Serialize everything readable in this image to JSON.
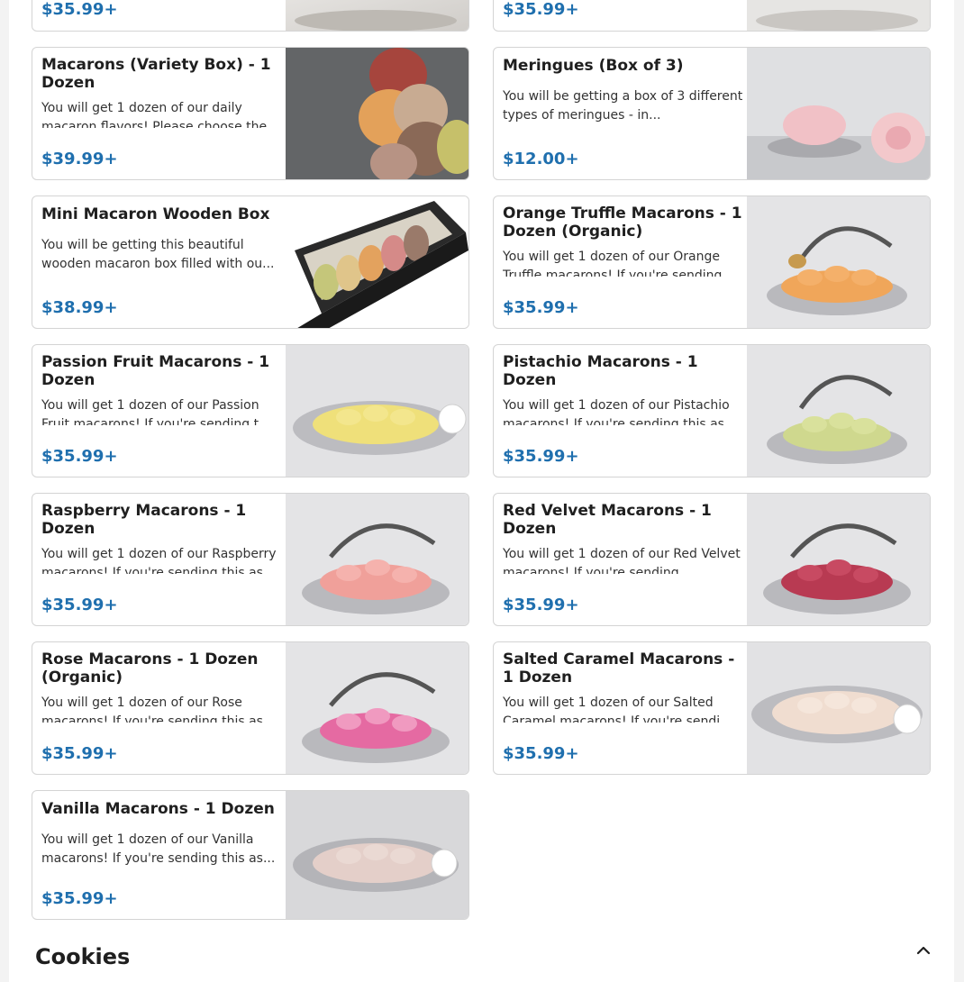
{
  "top_cards": [
    {
      "price": "$35.99+"
    },
    {
      "price": "$35.99+"
    }
  ],
  "items": [
    {
      "title": "Macarons (Variety Box) - 1 Dozen",
      "desc": "You will get 1 dozen of our daily macaron flavors! Please choose the",
      "price": "$39.99+",
      "image": "variety-macarons-image"
    },
    {
      "title": "Meringues (Box of 3)",
      "desc": "You will be getting a box of 3 different types of meringues - in...",
      "price": "$12.00+",
      "image": "meringues-image"
    },
    {
      "title": "Mini Macaron Wooden Box",
      "desc": "You will be getting this beautiful wooden macaron box filled with ou...",
      "price": "$38.99+",
      "image": "wooden-box-image"
    },
    {
      "title": "Orange Truffle Macarons - 1 Dozen (Organic)",
      "desc": "You will get 1 dozen of our Orange Truffle macarons! If you're sending",
      "price": "$35.99+",
      "image": "orange-macarons-image"
    },
    {
      "title": "Passion Fruit Macarons - 1 Dozen",
      "desc": "You will get 1 dozen of our Passion Fruit macarons! If you're sending t",
      "price": "$35.99+",
      "image": "passion-fruit-macarons-image"
    },
    {
      "title": "Pistachio Macarons - 1 Dozen",
      "desc": "You will get 1 dozen of our Pistachio macarons! If you're sending this as",
      "price": "$35.99+",
      "image": "pistachio-macarons-image"
    },
    {
      "title": "Raspberry Macarons - 1 Dozen",
      "desc": "You will get 1 dozen of our Raspberry macarons! If you're sending this as",
      "price": "$35.99+",
      "image": "raspberry-macarons-image"
    },
    {
      "title": "Red Velvet Macarons - 1 Dozen",
      "desc": "You will get 1 dozen of our Red Velvet macarons! If you're sending",
      "price": "$35.99+",
      "image": "red-velvet-macarons-image"
    },
    {
      "title": "Rose Macarons - 1 Dozen (Organic)",
      "desc": "You will get 1 dozen of our Rose macarons! If you're sending this as",
      "price": "$35.99+",
      "image": "rose-macarons-image"
    },
    {
      "title": "Salted Caramel Macarons - 1 Dozen",
      "desc": "You will get 1 dozen of our Salted Caramel macarons! If you're sendi",
      "price": "$35.99+",
      "image": "salted-caramel-macarons-image"
    },
    {
      "title": "Vanilla Macarons - 1 Dozen",
      "desc": "You will get 1 dozen of our Vanilla macarons! If you're sending this as...",
      "price": "$35.99+",
      "image": "vanilla-macarons-image"
    }
  ],
  "section": {
    "title": "Cookies",
    "icon": "chevron-up-icon"
  },
  "colors": {
    "price": "#1f6fae",
    "border": "#d4d4d4"
  }
}
